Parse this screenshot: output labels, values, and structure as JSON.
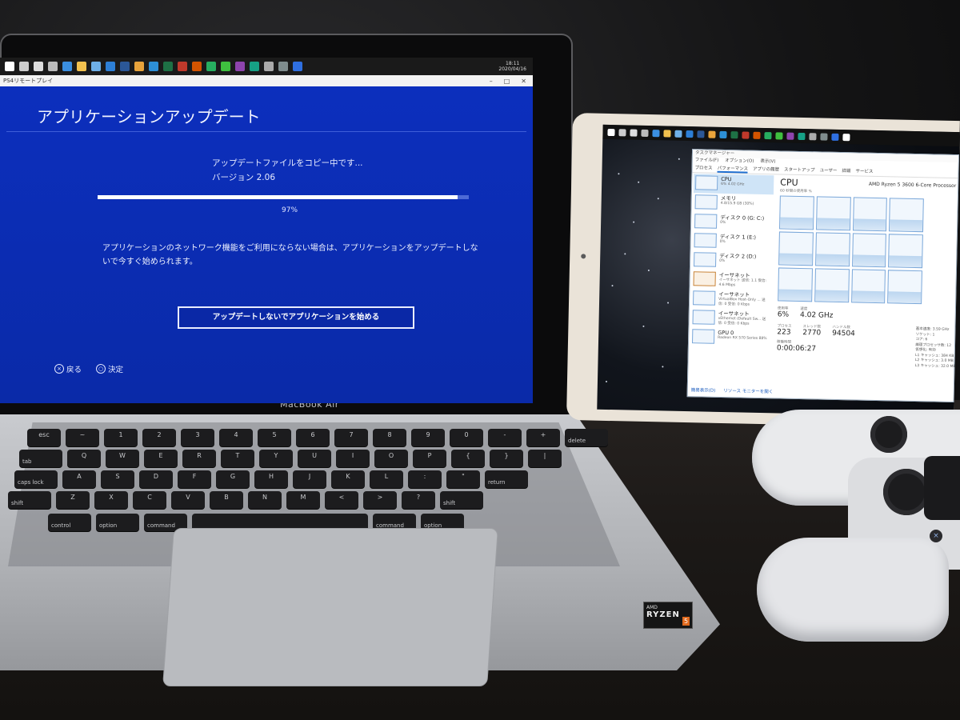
{
  "laptop": {
    "brand": "MacBook Air",
    "taskbar": {
      "time": "18:11",
      "date": "2020/04/16",
      "icons": [
        "windows-icon",
        "search-icon",
        "cortana-icon",
        "taskview-icon",
        "edge-icon",
        "explorer-icon",
        "store-icon",
        "mail-icon",
        "terminal-icon",
        "chrome-icon",
        "vscode-icon",
        "excel-icon",
        "app-icon",
        "app-icon",
        "app-icon",
        "line-icon",
        "app-icon",
        "app-icon",
        "app-icon",
        "app-icon",
        "remoteplay-icon"
      ]
    },
    "window": {
      "title": "PS4リモートプレイ",
      "controls": [
        "–",
        "□",
        "✕"
      ]
    },
    "ps4": {
      "title": "アプリケーションアップデート",
      "status": "アップデートファイルをコピー中です...",
      "version": "バージョン 2.06",
      "progress": 0.97,
      "progress_label": "97%",
      "note": "アプリケーションのネットワーク機能をご利用にならない場合は、アプリケーションをアップデートしないで今すぐ始められます。",
      "button_label": "アップデートしないでアプリケーションを始める",
      "nav_back_label": "戻る",
      "nav_confirm_label": "決定"
    },
    "keyboard": {
      "rows": [
        [
          "esc",
          "~",
          "1",
          "2",
          "3",
          "4",
          "5",
          "6",
          "7",
          "8",
          "9",
          "0",
          "-",
          "+",
          "delete"
        ],
        [
          "tab",
          "Q",
          "W",
          "E",
          "R",
          "T",
          "Y",
          "U",
          "I",
          "O",
          "P",
          "{",
          "}",
          "|"
        ],
        [
          "caps lock",
          "A",
          "S",
          "D",
          "F",
          "G",
          "H",
          "J",
          "K",
          "L",
          ":",
          "\"",
          "return"
        ],
        [
          "shift",
          "Z",
          "X",
          "C",
          "V",
          "B",
          "N",
          "M",
          "<",
          ">",
          "?",
          "shift"
        ],
        [
          "control",
          "option",
          "command",
          "",
          "command",
          "option"
        ]
      ]
    },
    "sticker": {
      "brand": "AMD",
      "line": "RYZEN",
      "tier": "5"
    }
  },
  "tablet": {
    "task_manager": {
      "title": "タスクマネージャー",
      "menu": [
        "ファイル(F)",
        "オプション(O)",
        "表示(V)"
      ],
      "tabs": [
        "プロセス",
        "パフォーマンス",
        "アプリの履歴",
        "スタートアップ",
        "ユーザー",
        "詳細",
        "サービス"
      ],
      "side": [
        {
          "label": "CPU",
          "sub": "6% 4.02 GHz"
        },
        {
          "label": "メモリ",
          "sub": "4.8/15.9 GB (30%)"
        },
        {
          "label": "ディスク 0 (G: C:)",
          "sub": "0%"
        },
        {
          "label": "ディスク 1 (E:)",
          "sub": "0%"
        },
        {
          "label": "ディスク 2 (D:)",
          "sub": "0%"
        },
        {
          "label": "イーサネット",
          "sub": "イーサネット 送信: 1.1 受信: 4.6 Mbps"
        },
        {
          "label": "イーサネット",
          "sub": "VirtualBox Host-Only ... 送信: 0 受信: 0 Kbps"
        },
        {
          "label": "イーサネット",
          "sub": "vEthernet (Default Sw... 送信: 0 受信: 0 Kbps"
        },
        {
          "label": "GPU 0",
          "sub": "Radeon RX 570 Series 88%"
        }
      ],
      "cpu_heading": "CPU",
      "cpu_model": "AMD Ryzen 5 3600 6-Core Processor",
      "util_label": "60 秒間の使用率 %",
      "stats": [
        {
          "k": "使用率",
          "v": "6%"
        },
        {
          "k": "速度",
          "v": "4.02 GHz"
        }
      ],
      "stats2": [
        {
          "k": "プロセス",
          "v": "223"
        },
        {
          "k": "スレッド数",
          "v": "2770"
        },
        {
          "k": "ハンドル数",
          "v": "94504"
        }
      ],
      "uptime_label": "稼働時間",
      "uptime": "0:00:06:27",
      "specs": [
        "基本速度: 3.59 GHz",
        "ソケット: 1",
        "コア: 6",
        "論理プロセッサ数: 12",
        "仮想化: 有効",
        "L1 キャッシュ: 384 KB",
        "L2 キャッシュ: 3.0 MB",
        "L3 キャッシュ: 32.0 MB"
      ],
      "footer_less": "簡易表示(D)",
      "footer_monitor": "リソース モニターを開く"
    }
  }
}
